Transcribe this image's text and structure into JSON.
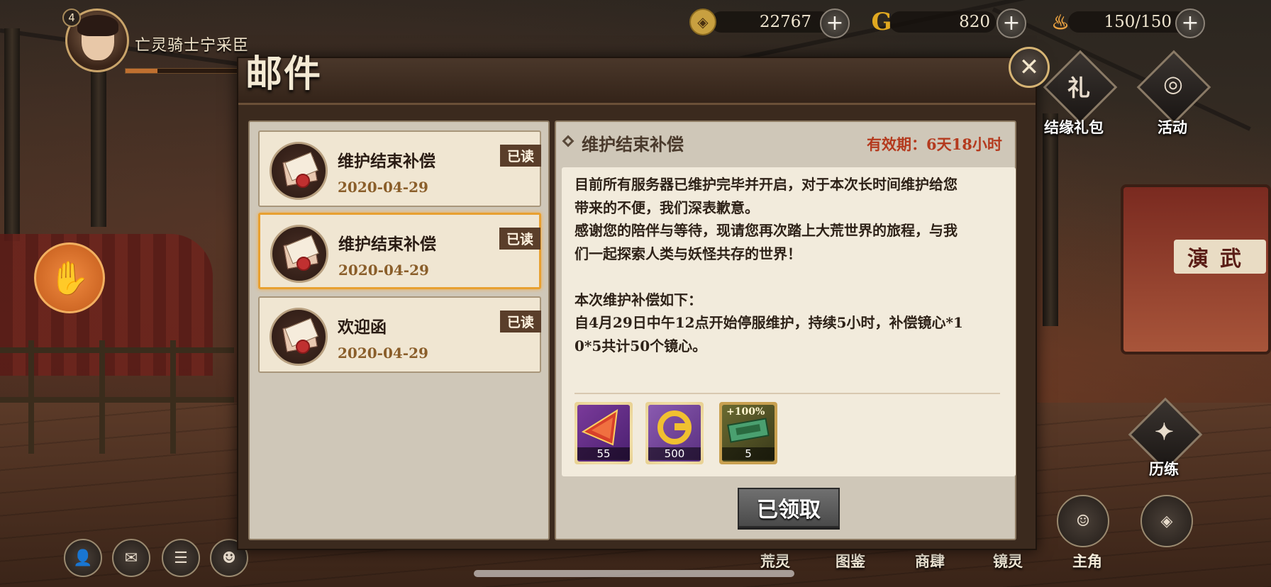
{
  "player": {
    "level": "4",
    "name": "亡灵骑士宁采臣",
    "exp_fraction": 0.25
  },
  "resources": [
    {
      "icon": "coin-icon",
      "value": "22767",
      "color": "#d8b040"
    },
    {
      "icon": "mirror-heart-icon",
      "value": "820",
      "color": "#e0a020"
    },
    {
      "icon": "stamina-gourd-icon",
      "value": "150/150",
      "color": "#e88a3a"
    }
  ],
  "dialog": {
    "title": "邮件",
    "close_icon": "✕",
    "mails": [
      {
        "subject": "维护结束补偿",
        "date": "2020-04-29",
        "status": "已读",
        "selected": false
      },
      {
        "subject": "维护结束补偿",
        "date": "2020-04-29",
        "status": "已读",
        "selected": true
      },
      {
        "subject": "欢迎函",
        "date": "2020-04-29",
        "status": "已读",
        "selected": false
      }
    ],
    "detail": {
      "subject": "维护结束补偿",
      "validity": "有效期：6天18小时",
      "body": "目前所有服务器已维护完毕并开启，对于本次长时间维护给您\n带来的不便，我们深表歉意。\n感谢您的陪伴与等待，现请您再次踏上大荒世界的旅程，与我\n们一起探索人类与妖怪共存的世界！\n\n本次维护补偿如下：\n自4月29日中午12点开始停服维护，持续5小时，补偿镜心*1\n0*5共计50个镜心。",
      "rewards": [
        {
          "icon": "red-crystal-icon",
          "count": "55",
          "color": "#b02a2a"
        },
        {
          "icon": "gold-mirror-icon",
          "count": "500",
          "color": "#7a4aa0"
        },
        {
          "icon": "exp-boost-ticket-icon",
          "count": "5",
          "color": "#5a5a2a",
          "badge": "+100%"
        }
      ],
      "claim_button": "已领取"
    }
  },
  "side_menu": [
    {
      "label": "结缘礼包",
      "glyph": "礼"
    },
    {
      "label": "活动",
      "glyph": "◎"
    },
    {
      "label": "历练",
      "glyph": "✦"
    }
  ],
  "bottom_nav": [
    "荒灵",
    "图鉴",
    "商肆",
    "镜灵",
    "主角"
  ],
  "stage_sign": "演武"
}
